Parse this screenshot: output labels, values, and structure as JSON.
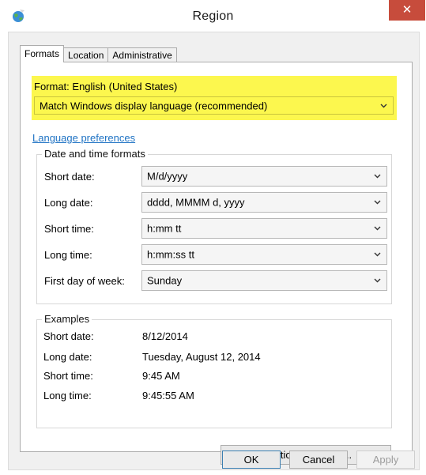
{
  "window": {
    "title": "Region",
    "close_glyph": "✕",
    "icon": "globe-icon"
  },
  "tabs": [
    {
      "label": "Formats",
      "active": true
    },
    {
      "label": "Location",
      "active": false
    },
    {
      "label": "Administrative",
      "active": false
    }
  ],
  "format": {
    "label": "Format: English (United States)",
    "selected": "Match Windows display language (recommended)",
    "highlight_color": "#fcf74e"
  },
  "language_preferences_link": "Language preferences",
  "date_time_formats": {
    "title": "Date and time formats",
    "rows": [
      {
        "label": "Short date:",
        "value": "M/d/yyyy"
      },
      {
        "label": "Long date:",
        "value": "dddd, MMMM d, yyyy"
      },
      {
        "label": "Short time:",
        "value": "h:mm tt"
      },
      {
        "label": "Long time:",
        "value": "h:mm:ss tt"
      },
      {
        "label": "First day of week:",
        "value": "Sunday"
      }
    ]
  },
  "examples": {
    "title": "Examples",
    "rows": [
      {
        "label": "Short date:",
        "value": "8/12/2014"
      },
      {
        "label": "Long date:",
        "value": "Tuesday, August 12, 2014"
      },
      {
        "label": "Short time:",
        "value": "9:45 AM"
      },
      {
        "label": "Long time:",
        "value": "9:45:55 AM"
      }
    ]
  },
  "buttons": {
    "additional_settings": "Additional settings...",
    "ok": "OK",
    "cancel": "Cancel",
    "apply": "Apply"
  },
  "colors": {
    "close_button": "#c74c3c",
    "link": "#1f73c4"
  }
}
